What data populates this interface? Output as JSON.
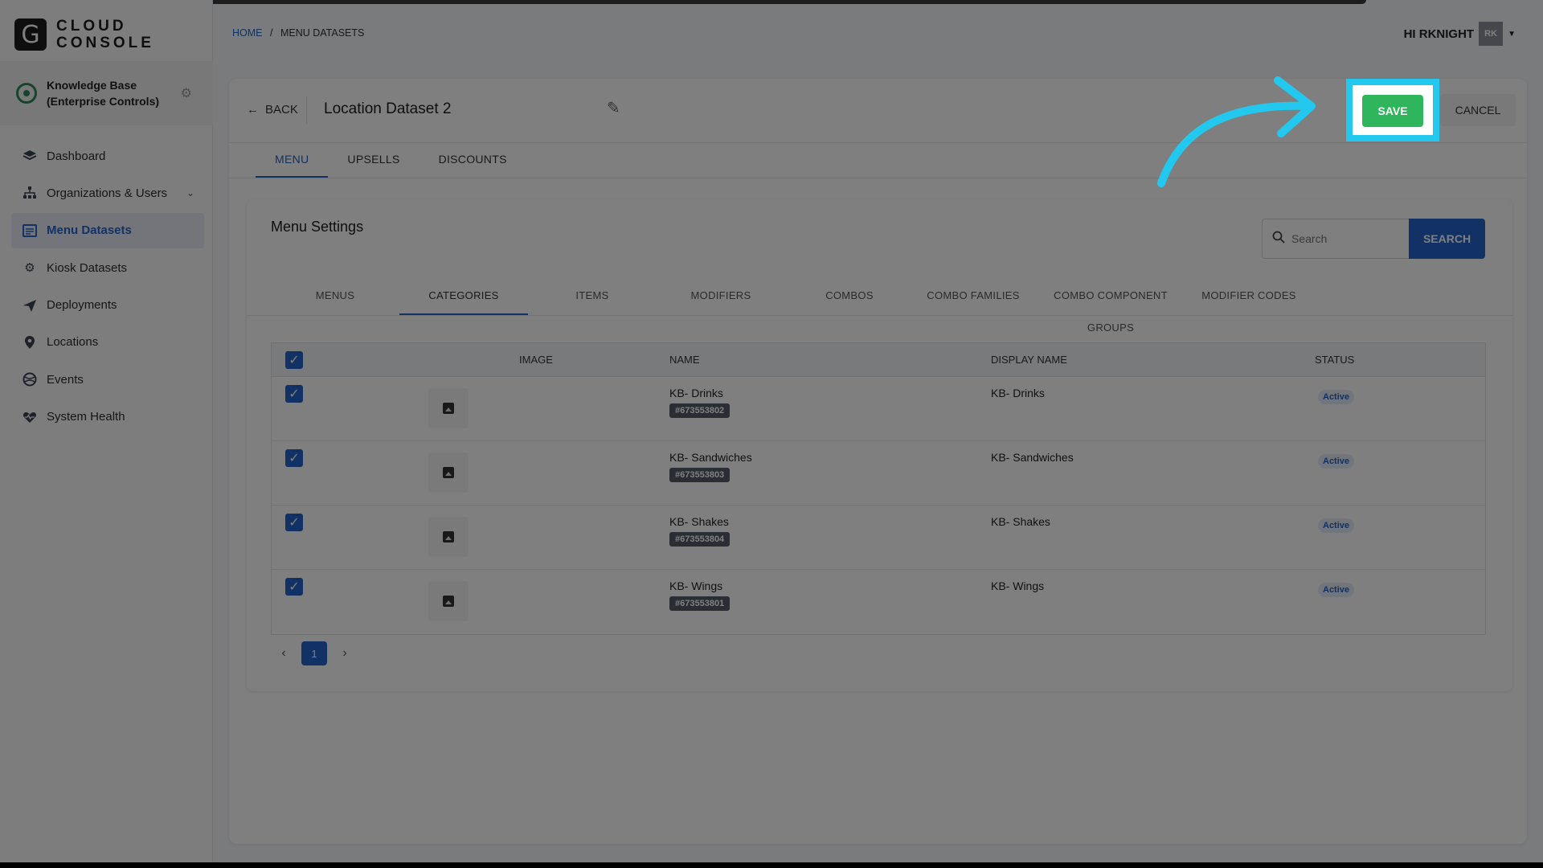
{
  "app": {
    "logo_letter": "G",
    "logo_line1": "CLOUD",
    "logo_line2": "CONSOLE"
  },
  "org": {
    "name": "Knowledge Base (Enterprise Controls)"
  },
  "sidebar": {
    "items": [
      {
        "label": "Dashboard",
        "icon": "layers-icon"
      },
      {
        "label": "Organizations & Users",
        "icon": "org-chart-icon"
      },
      {
        "label": "Menu Datasets",
        "icon": "menu-dataset-icon",
        "active": true
      },
      {
        "label": "Kiosk Datasets",
        "icon": "gear-icon"
      },
      {
        "label": "Deployments",
        "icon": "send-icon"
      },
      {
        "label": "Locations",
        "icon": "map-pin-icon"
      },
      {
        "label": "Events",
        "icon": "events-icon"
      },
      {
        "label": "System Health",
        "icon": "heart-pulse-icon"
      }
    ]
  },
  "header": {
    "crumb_home": "HOME",
    "crumb_sep": "/",
    "crumb_current": "MENU DATASETS",
    "greeting": "HI RKNIGHT",
    "avatar_initials": "RK"
  },
  "dataset": {
    "back_label": "BACK",
    "title": "Location Dataset 2",
    "save_label": "SAVE",
    "cancel_label": "CANCEL"
  },
  "main_tabs": [
    "MENU",
    "UPSELLS",
    "DISCOUNTS"
  ],
  "panel": {
    "title": "Menu Settings",
    "search_placeholder": "Search",
    "search_button": "SEARCH"
  },
  "sub_tabs": [
    "MENUS",
    "CATEGORIES",
    "ITEMS",
    "MODIFIERS",
    "COMBOS",
    "COMBO FAMILIES",
    "COMBO COMPONENT GROUPS",
    "MODIFIER CODES"
  ],
  "table": {
    "headers": {
      "image": "IMAGE",
      "name": "NAME",
      "display_name": "DISPLAY NAME",
      "status": "STATUS"
    },
    "rows": [
      {
        "name": "KB- Drinks",
        "id": "#673553802",
        "display_name": "KB- Drinks",
        "status": "Active"
      },
      {
        "name": "KB- Sandwiches",
        "id": "#673553803",
        "display_name": "KB- Sandwiches",
        "status": "Active"
      },
      {
        "name": "KB- Shakes",
        "id": "#673553804",
        "display_name": "KB- Shakes",
        "status": "Active"
      },
      {
        "name": "KB- Wings",
        "id": "#673553801",
        "display_name": "KB- Wings",
        "status": "Active"
      }
    ]
  },
  "pagination": {
    "current_page": "1"
  },
  "colors": {
    "accent": "#2563c9",
    "save": "#2fb55c",
    "highlight": "#23c8ef"
  }
}
